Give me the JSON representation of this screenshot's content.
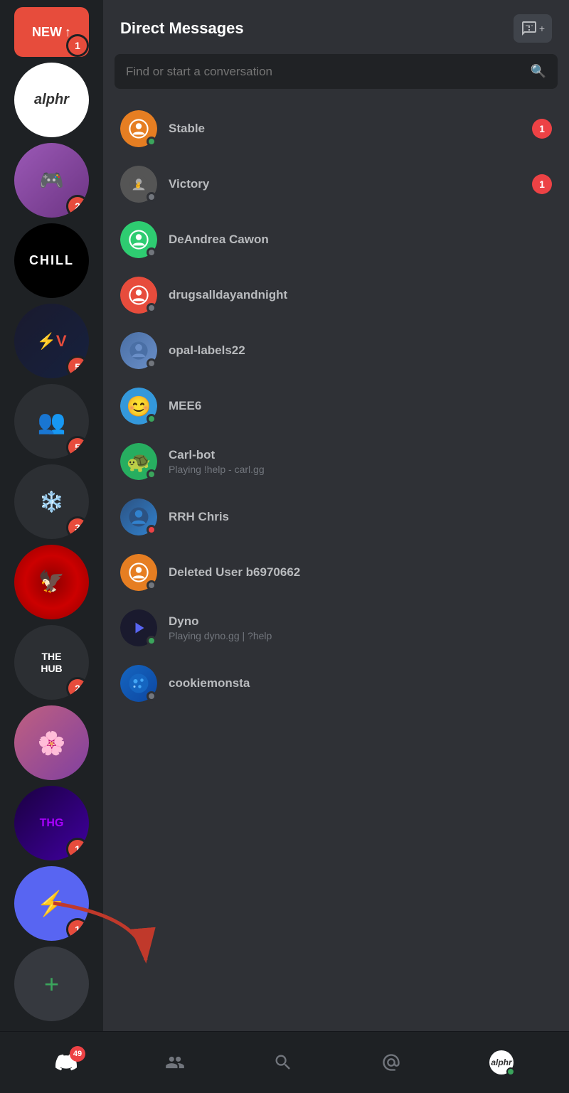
{
  "app": {
    "title": "Discord"
  },
  "header": {
    "title": "Direct Messages",
    "new_dm_icon": "➕"
  },
  "search": {
    "placeholder": "Find or start a conversation"
  },
  "servers": [
    {
      "id": "new",
      "label": "NEW",
      "badge": 1,
      "type": "new"
    },
    {
      "id": "alphr",
      "label": "alphr",
      "badge": 0,
      "type": "alphr"
    },
    {
      "id": "purple",
      "label": "",
      "badge": 2,
      "type": "purple"
    },
    {
      "id": "chill",
      "label": "CHILL",
      "badge": 0,
      "type": "chill"
    },
    {
      "id": "na",
      "label": "",
      "badge": 5,
      "type": "na"
    },
    {
      "id": "group",
      "label": "",
      "badge": 5,
      "type": "group"
    },
    {
      "id": "squad",
      "label": "",
      "badge": 3,
      "type": "squad"
    },
    {
      "id": "red",
      "label": "",
      "badge": 0,
      "type": "red"
    },
    {
      "id": "hub",
      "label": "",
      "badge": 2,
      "type": "hub"
    },
    {
      "id": "anime",
      "label": "",
      "badge": 0,
      "type": "anime"
    },
    {
      "id": "thg",
      "label": "",
      "badge": 1,
      "type": "thg"
    },
    {
      "id": "thunder",
      "label": "",
      "badge": 1,
      "type": "thunder"
    },
    {
      "id": "add",
      "label": "+",
      "badge": 0,
      "type": "add"
    }
  ],
  "dm_list": [
    {
      "id": "stable",
      "name": "Stable",
      "status": "online",
      "unread": 1,
      "avatar_type": "discord_orange",
      "status_text": ""
    },
    {
      "id": "victory",
      "name": "Victory",
      "status": "offline",
      "unread": 1,
      "avatar_type": "victory",
      "status_text": ""
    },
    {
      "id": "deandrea",
      "name": "DeAndrea Cawon",
      "status": "offline",
      "unread": 0,
      "avatar_type": "discord_green",
      "status_text": ""
    },
    {
      "id": "drugs",
      "name": "drugsalldayandnight",
      "status": "offline",
      "unread": 0,
      "avatar_type": "discord_red",
      "status_text": ""
    },
    {
      "id": "opal",
      "name": "opal-labels22",
      "status": "offline",
      "unread": 0,
      "avatar_type": "opal",
      "status_text": ""
    },
    {
      "id": "mee6",
      "name": "MEE6",
      "status": "online",
      "unread": 0,
      "avatar_type": "mee6",
      "status_text": ""
    },
    {
      "id": "carlbot",
      "name": "Carl-bot",
      "status": "online",
      "unread": 0,
      "avatar_type": "carlbot",
      "status_text": "Playing !help - carl.gg"
    },
    {
      "id": "rrh",
      "name": "RRH Chris",
      "status": "dnd",
      "unread": 0,
      "avatar_type": "rrh",
      "status_text": ""
    },
    {
      "id": "deleted",
      "name": "Deleted User b6970662",
      "status": "offline",
      "unread": 0,
      "avatar_type": "discord_orange",
      "status_text": ""
    },
    {
      "id": "dyno",
      "name": "Dyno",
      "status": "online",
      "unread": 0,
      "avatar_type": "dyno",
      "status_text": "Playing dyno.gg | ?help"
    },
    {
      "id": "cookiemonsta",
      "name": "cookiemonsta",
      "status": "offline",
      "unread": 0,
      "avatar_type": "cookie",
      "status_text": ""
    }
  ],
  "bottom_nav": {
    "items": [
      {
        "id": "home",
        "label": "",
        "icon": "home",
        "badge": 49,
        "active": true
      },
      {
        "id": "friends",
        "label": "",
        "icon": "friends",
        "badge": 0,
        "active": false
      },
      {
        "id": "search",
        "label": "",
        "icon": "search",
        "badge": 0,
        "active": false
      },
      {
        "id": "mentions",
        "label": "",
        "icon": "at",
        "badge": 0,
        "active": false
      },
      {
        "id": "profile",
        "label": "alphr",
        "icon": "avatar",
        "badge": 0,
        "active": false
      }
    ]
  }
}
